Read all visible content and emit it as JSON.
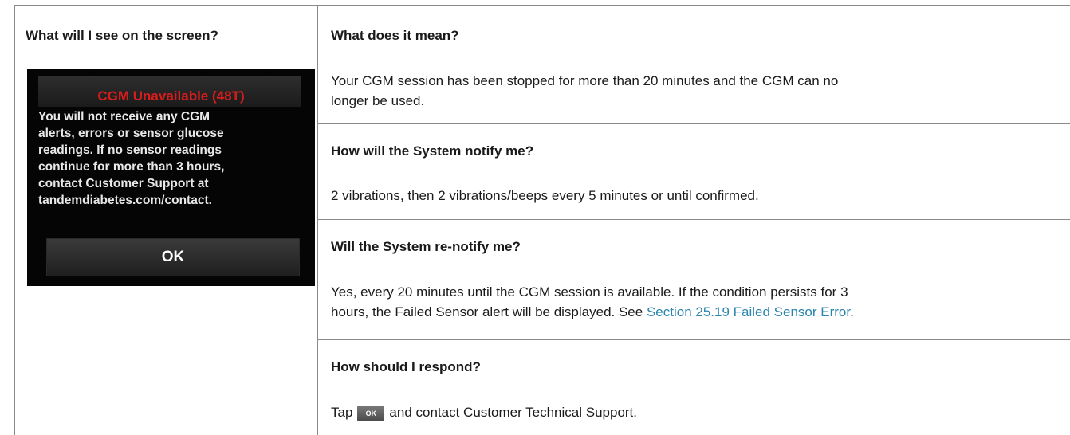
{
  "left_column": {
    "header": "What will I see on the screen?",
    "device_screen": {
      "title": "CGM Unavailable (48T)",
      "body": "You will not receive any CGM\nalerts, errors or sensor glucose\nreadings. If no sensor readings\ncontinue for more than 3 hours,\ncontact Customer Support at\ntandemdiabetes.com/contact.",
      "ok_label": "OK"
    }
  },
  "right_column": {
    "meaning": {
      "header": "What does it mean?",
      "line1": "Your CGM session has been stopped for more than 20 minutes and the CGM can no",
      "line2": "longer be used."
    },
    "notify": {
      "header": "How will the System notify me?",
      "text": "2 vibrations, then 2 vibrations/beeps every 5 minutes or until confirmed."
    },
    "renotify": {
      "header": "Will the System re-notify me?",
      "line1": "Yes, every 20 minutes until the CGM session is available. If the condition persists for 3",
      "line2_prefix": "hours, the Failed Sensor alert will be displayed. See ",
      "line2_link": "Section 25.19 Failed Sensor Error",
      "line2_suffix": "."
    },
    "respond": {
      "header": "How should I respond?",
      "text_prefix": "Tap",
      "ok_icon_label": "OK",
      "text_suffix": "and contact Customer Technical Support."
    }
  },
  "colors": {
    "link": "#2a85ad",
    "alert_title": "#d91d1d",
    "border": "#8a8a8a"
  }
}
